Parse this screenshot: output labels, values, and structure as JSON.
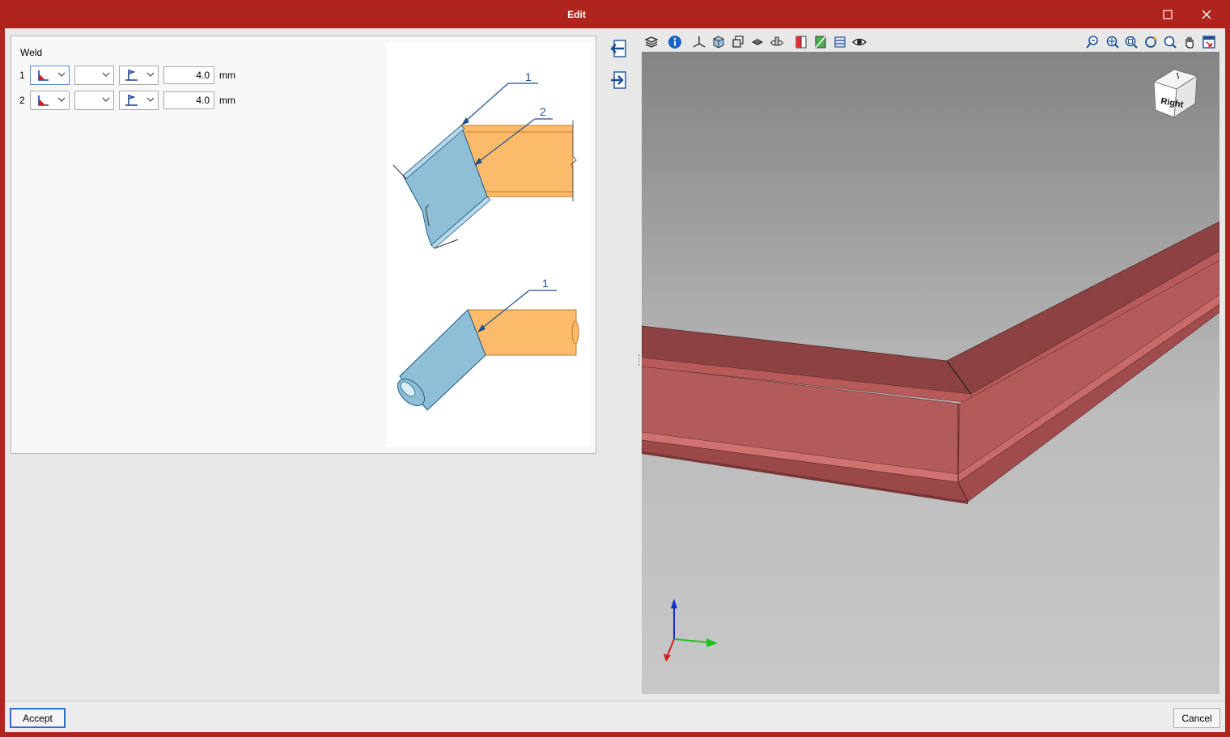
{
  "window": {
    "title": "Edit",
    "maximize_icon": "maximize-icon",
    "close_icon": "close-icon"
  },
  "weld": {
    "title": "Weld",
    "rows": [
      {
        "number": "1",
        "type_icon": "fillet-weld-icon",
        "option": "",
        "finish_icon": "field-weld-flag-icon",
        "value": "4.0",
        "unit": "mm"
      },
      {
        "number": "2",
        "type_icon": "fillet-weld-icon",
        "option": "",
        "finish_icon": "field-weld-flag-icon",
        "value": "4.0",
        "unit": "mm"
      }
    ]
  },
  "figure": {
    "callout_top_1": "1",
    "callout_top_2": "2",
    "callout_bottom_1": "1"
  },
  "side_buttons": [
    "import-icon",
    "export-icon"
  ],
  "toolbar": {
    "left": [
      "layers-icon",
      "info-icon",
      "axes-icon",
      "shaded-view-icon",
      "wireframe-view-icon",
      "render-view-icon",
      "orbit-icon",
      "section-icon",
      "clip-plane-icon",
      "grid-icon",
      "visibility-icon"
    ],
    "right": [
      "zoom-previous-icon",
      "zoom-all-icon",
      "zoom-window-icon",
      "refresh-zoom-icon",
      "zoom-icon",
      "pan-icon",
      "fit-window-icon"
    ]
  },
  "viewcube": {
    "label": "Right"
  },
  "colors": {
    "member": "#b35a5a",
    "member_top": "#8c4242",
    "titlebar": "#b0241e",
    "figure_blue": "#8fbfd6",
    "figure_orange": "#fbbb6a"
  },
  "footer": {
    "accept_label": "Accept",
    "cancel_label": "Cancel"
  }
}
